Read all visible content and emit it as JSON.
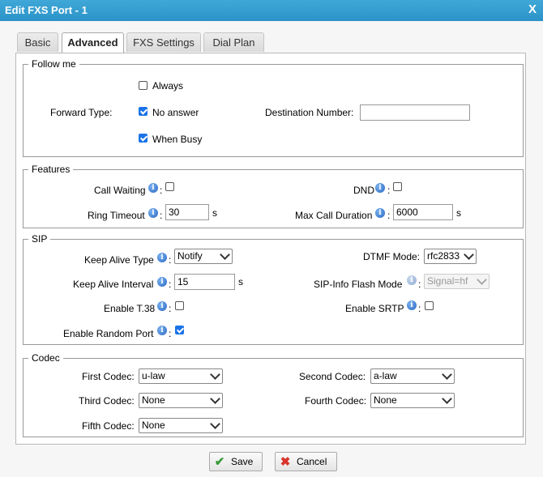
{
  "window": {
    "title": "Edit FXS Port - 1",
    "close_label": "X"
  },
  "tabs": [
    {
      "label": "Basic",
      "active": false
    },
    {
      "label": "Advanced",
      "active": true
    },
    {
      "label": "FXS Settings",
      "active": false
    },
    {
      "label": "Dial Plan",
      "active": false
    }
  ],
  "follow_me": {
    "legend": "Follow me",
    "forward_type_label": "Forward Type:",
    "always_label": "Always",
    "always_checked": false,
    "no_answer_label": "No answer",
    "no_answer_checked": true,
    "when_busy_label": "When Busy",
    "when_busy_checked": true,
    "destination_label": "Destination Number:",
    "destination_value": ""
  },
  "features": {
    "legend": "Features",
    "call_waiting_label": "Call Waiting",
    "call_waiting_checked": false,
    "dnd_label": "DND",
    "dnd_checked": false,
    "ring_timeout_label": "Ring Timeout",
    "ring_timeout_value": "30",
    "ring_timeout_unit": "s",
    "max_call_duration_label": "Max Call Duration",
    "max_call_duration_value": "6000",
    "max_call_duration_unit": "s"
  },
  "sip": {
    "legend": "SIP",
    "keep_alive_type_label": "Keep Alive Type",
    "keep_alive_type_value": "Notify",
    "dtmf_mode_label": "DTMF Mode:",
    "dtmf_mode_value": "rfc2833",
    "keep_alive_interval_label": "Keep Alive Interval",
    "keep_alive_interval_value": "15",
    "keep_alive_interval_unit": "s",
    "sip_info_flash_label": "SIP-Info Flash Mode",
    "sip_info_flash_value": "Signal=hf",
    "enable_t38_label": "Enable T.38",
    "enable_t38_checked": false,
    "enable_srtp_label": "Enable SRTP",
    "enable_srtp_checked": false,
    "enable_random_port_label": "Enable Random Port",
    "enable_random_port_checked": true
  },
  "codec": {
    "legend": "Codec",
    "first_label": "First Codec:",
    "first_value": "u-law",
    "second_label": "Second Codec:",
    "second_value": "a-law",
    "third_label": "Third Codec:",
    "third_value": "None",
    "fourth_label": "Fourth Codec:",
    "fourth_value": "None",
    "fifth_label": "Fifth Codec:",
    "fifth_value": "None"
  },
  "colon": ":",
  "info_glyph": "i",
  "buttons": {
    "save_label": "Save",
    "cancel_label": "Cancel"
  },
  "colors": {
    "titlebar": "#2c93c8",
    "check": "#1a73e8",
    "save_icon": "#3a9a3a",
    "cancel_icon": "#d9342b"
  }
}
